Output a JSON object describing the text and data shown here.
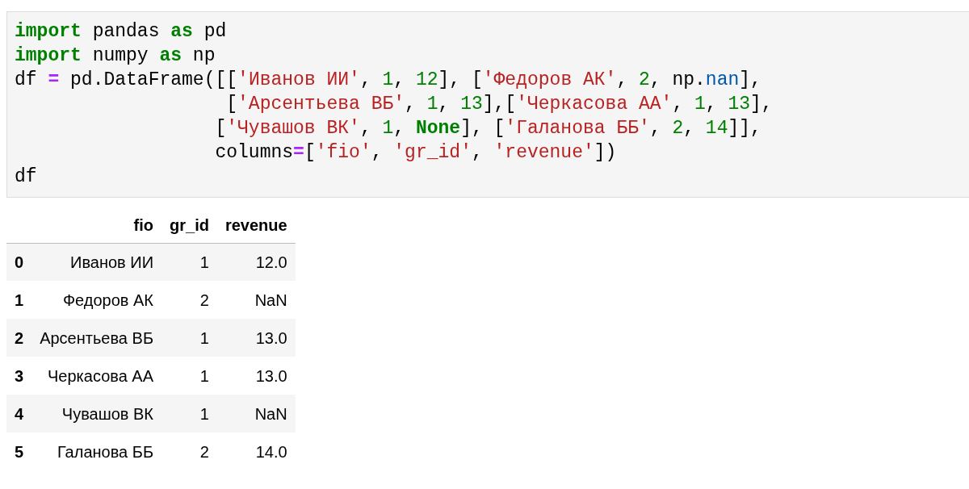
{
  "code_cell": {
    "lines": [
      [
        {
          "kind": "keyword",
          "text": "import"
        },
        {
          "kind": "plain",
          "text": " pandas "
        },
        {
          "kind": "keyword",
          "text": "as"
        },
        {
          "kind": "plain",
          "text": " pd"
        }
      ],
      [
        {
          "kind": "keyword",
          "text": "import"
        },
        {
          "kind": "plain",
          "text": " numpy "
        },
        {
          "kind": "keyword",
          "text": "as"
        },
        {
          "kind": "plain",
          "text": " np"
        }
      ],
      [
        {
          "kind": "plain",
          "text": "df "
        },
        {
          "kind": "operator",
          "text": "="
        },
        {
          "kind": "plain",
          "text": " pd.DataFrame([["
        },
        {
          "kind": "string",
          "text": "'Иванов ИИ'"
        },
        {
          "kind": "plain",
          "text": ", "
        },
        {
          "kind": "number",
          "text": "1"
        },
        {
          "kind": "plain",
          "text": ", "
        },
        {
          "kind": "number",
          "text": "12"
        },
        {
          "kind": "plain",
          "text": "], ["
        },
        {
          "kind": "string",
          "text": "'Федоров АК'"
        },
        {
          "kind": "plain",
          "text": ", "
        },
        {
          "kind": "number",
          "text": "2"
        },
        {
          "kind": "plain",
          "text": ", np."
        },
        {
          "kind": "attribute",
          "text": "nan"
        },
        {
          "kind": "plain",
          "text": "],"
        }
      ],
      [
        {
          "kind": "plain",
          "text": "                   ["
        },
        {
          "kind": "string",
          "text": "'Арсентьева ВБ'"
        },
        {
          "kind": "plain",
          "text": ", "
        },
        {
          "kind": "number",
          "text": "1"
        },
        {
          "kind": "plain",
          "text": ", "
        },
        {
          "kind": "number",
          "text": "13"
        },
        {
          "kind": "plain",
          "text": "],["
        },
        {
          "kind": "string",
          "text": "'Черкасова АА'"
        },
        {
          "kind": "plain",
          "text": ", "
        },
        {
          "kind": "number",
          "text": "1"
        },
        {
          "kind": "plain",
          "text": ", "
        },
        {
          "kind": "number",
          "text": "13"
        },
        {
          "kind": "plain",
          "text": "],"
        }
      ],
      [
        {
          "kind": "plain",
          "text": "                  ["
        },
        {
          "kind": "string",
          "text": "'Чувашов ВК'"
        },
        {
          "kind": "plain",
          "text": ", "
        },
        {
          "kind": "number",
          "text": "1"
        },
        {
          "kind": "plain",
          "text": ", "
        },
        {
          "kind": "keyword",
          "text": "None"
        },
        {
          "kind": "plain",
          "text": "], ["
        },
        {
          "kind": "string",
          "text": "'Галанова ББ'"
        },
        {
          "kind": "plain",
          "text": ", "
        },
        {
          "kind": "number",
          "text": "2"
        },
        {
          "kind": "plain",
          "text": ", "
        },
        {
          "kind": "number",
          "text": "14"
        },
        {
          "kind": "plain",
          "text": "]],"
        }
      ],
      [
        {
          "kind": "plain",
          "text": "                  columns"
        },
        {
          "kind": "operator",
          "text": "="
        },
        {
          "kind": "plain",
          "text": "["
        },
        {
          "kind": "string",
          "text": "'fio'"
        },
        {
          "kind": "plain",
          "text": ", "
        },
        {
          "kind": "string",
          "text": "'gr_id'"
        },
        {
          "kind": "plain",
          "text": ", "
        },
        {
          "kind": "string",
          "text": "'revenue'"
        },
        {
          "kind": "plain",
          "text": "])"
        }
      ],
      [
        {
          "kind": "plain",
          "text": "df"
        }
      ]
    ]
  },
  "output_table": {
    "columns": [
      "fio",
      "gr_id",
      "revenue"
    ],
    "rows": [
      {
        "index": "0",
        "cells": [
          "Иванов ИИ",
          "1",
          "12.0"
        ]
      },
      {
        "index": "1",
        "cells": [
          "Федоров АК",
          "2",
          "NaN"
        ]
      },
      {
        "index": "2",
        "cells": [
          "Арсентьева ВБ",
          "1",
          "13.0"
        ]
      },
      {
        "index": "3",
        "cells": [
          "Черкасова АА",
          "1",
          "13.0"
        ]
      },
      {
        "index": "4",
        "cells": [
          "Чувашов ВК",
          "1",
          "NaN"
        ]
      },
      {
        "index": "5",
        "cells": [
          "Галанова ББ",
          "2",
          "14.0"
        ]
      }
    ]
  }
}
